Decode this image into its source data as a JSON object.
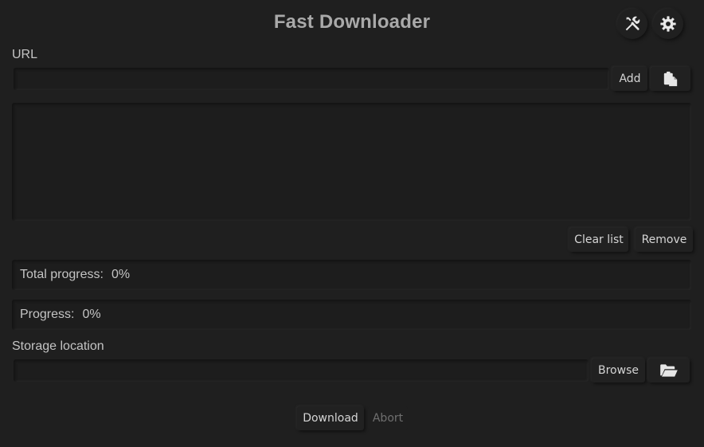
{
  "header": {
    "title": "Fast Downloader"
  },
  "icons": {
    "tools": "tools-icon",
    "settings": "gear-icon",
    "paste": "clipboard-icon",
    "folder": "folder-open-icon"
  },
  "url": {
    "label": "URL",
    "value": "",
    "placeholder": "",
    "add_label": "Add"
  },
  "list": {
    "items": [],
    "clear_label": "Clear list",
    "remove_label": "Remove"
  },
  "total_progress": {
    "label": "Total progress:",
    "value": "0%"
  },
  "progress": {
    "label": "Progress:",
    "value": "0%"
  },
  "storage": {
    "label": "Storage location",
    "value": "",
    "browse_label": "Browse"
  },
  "footer": {
    "download_label": "Download",
    "abort_label": "Abort"
  }
}
